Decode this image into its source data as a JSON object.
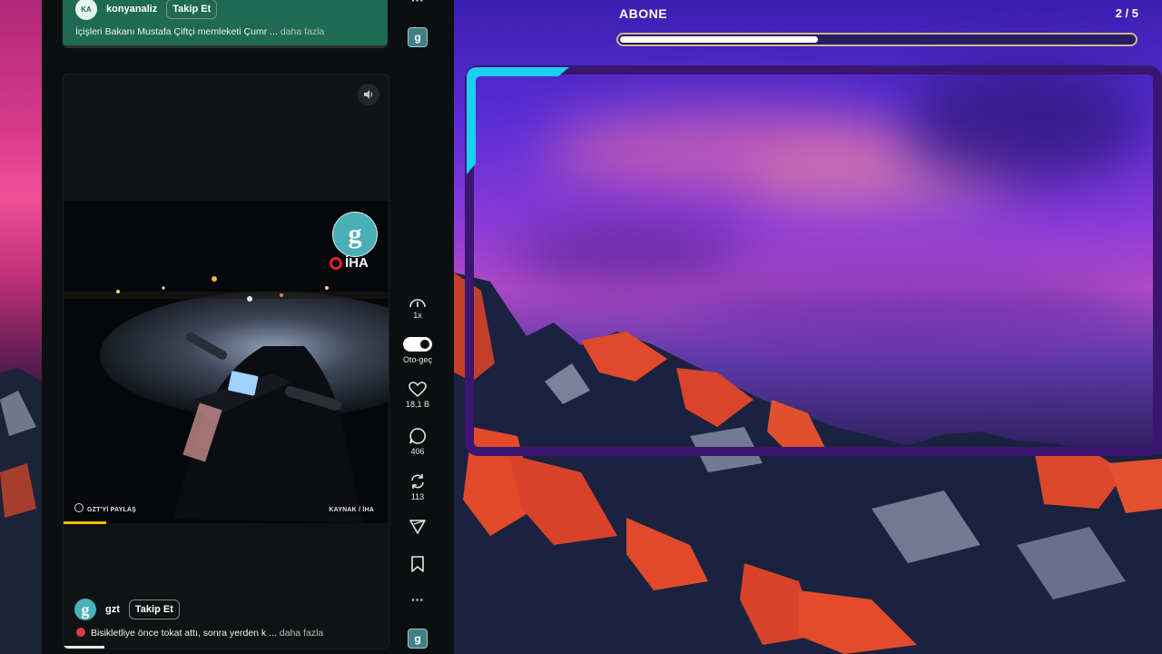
{
  "previous_post": {
    "author": "konyanaliz",
    "avatar_text": "KA",
    "follow_label": "Takip Et",
    "caption": "İçişleri Bakanı Mustafa Çiftçi memleketi Çumr ...",
    "more_label": "daha fazla"
  },
  "current_post": {
    "author": "gzt",
    "avatar_text": "g",
    "follow_label": "Takip Et",
    "caption": "Bisikletliye önce tokat attı, sonra yerden k ...",
    "more_label": "daha fazla",
    "video": {
      "logo_letter": "g",
      "agency": "İHA",
      "share_text": "GZT'Yİ PAYLAŞ",
      "source_text": "KAYNAK / İHA",
      "progress": 0.13
    }
  },
  "rail": {
    "top_more": "···",
    "speed": "1x",
    "autoplay": "Oto-geç",
    "likes": "18,1 B",
    "comments": "406",
    "reposts": "113",
    "more": "···",
    "logo_letter": "g"
  },
  "overlay": {
    "title": "ABONE",
    "counter": "2 / 5",
    "progress": 0.39
  },
  "colors": {
    "accent_cyan": "#1ad0f0",
    "frame_purple": "#3a1670",
    "brand_green": "#1f6a52",
    "video_progress": "#f2c200"
  }
}
